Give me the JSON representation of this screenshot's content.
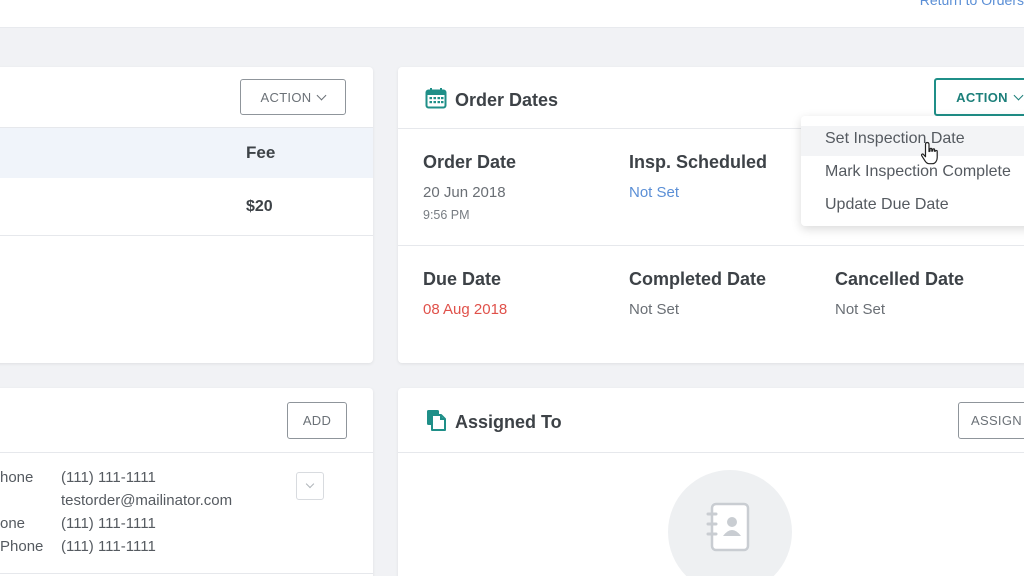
{
  "top_link": "Return to Orders",
  "fees_card": {
    "action_label": "ACTION",
    "fee_header": "Fee",
    "fee_value": "$20"
  },
  "contacts_card": {
    "add_label": "ADD",
    "rows": [
      {
        "type": "hone",
        "value": "(111) 111-1111"
      },
      {
        "type": "",
        "value": "testorder@mailinator.com"
      },
      {
        "type": "one",
        "value": "(111) 111-1111"
      },
      {
        "type": "Phone",
        "value": "(111) 111-1111"
      }
    ]
  },
  "order_dates": {
    "title": "Order Dates",
    "action_label": "ACTION",
    "order_date_label": "Order Date",
    "order_date": "20 Jun 2018",
    "order_time": "9:56 PM",
    "insp_scheduled_label": "Insp. Scheduled",
    "insp_scheduled_value": "Not Set",
    "due_date_label": "Due Date",
    "due_date": "08 Aug 2018",
    "completed_date_label": "Completed Date",
    "completed_date_value": "Not Set",
    "cancelled_date_label": "Cancelled Date",
    "cancelled_date_value": "Not Set"
  },
  "action_menu": {
    "items": [
      "Set Inspection Date",
      "Mark Inspection Complete",
      "Update Due Date"
    ]
  },
  "assigned_to": {
    "title": "Assigned To",
    "assign_label": "ASSIGN"
  },
  "colors": {
    "accent": "#1f8f88",
    "link": "#5b8fd6",
    "overdue": "#e0514a"
  },
  "icons": [
    "calendar-icon",
    "documents-icon",
    "chevron-down-icon",
    "contact-book-icon",
    "hand-cursor-icon"
  ]
}
